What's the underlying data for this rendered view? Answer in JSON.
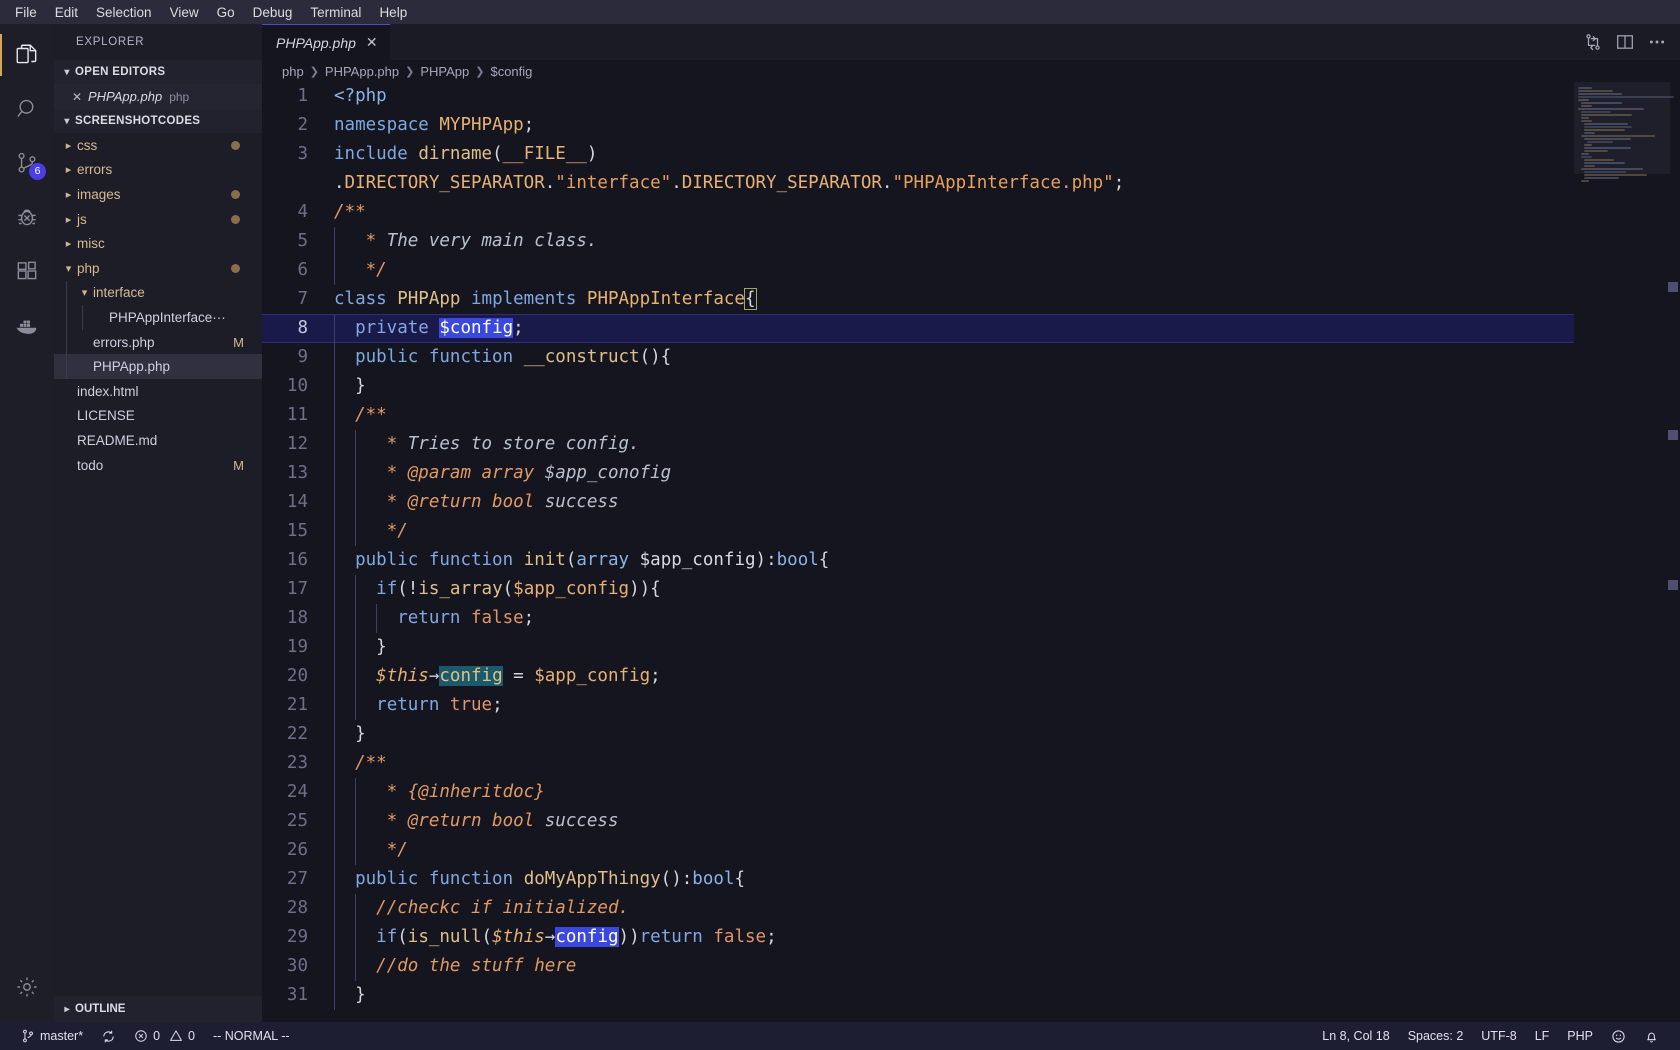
{
  "menubar": {
    "items": [
      {
        "label": "File"
      },
      {
        "label": "Edit"
      },
      {
        "label": "Selection"
      },
      {
        "label": "View"
      },
      {
        "label": "Go"
      },
      {
        "label": "Debug"
      },
      {
        "label": "Terminal"
      },
      {
        "label": "Help"
      }
    ]
  },
  "activitybar": {
    "items": [
      {
        "icon": "files-explorer-icon",
        "name": "explorer",
        "active": true,
        "badge": ""
      },
      {
        "icon": "search-icon",
        "name": "search",
        "active": false,
        "badge": ""
      },
      {
        "icon": "source-control-icon",
        "name": "source-control",
        "active": false,
        "badge": "6"
      },
      {
        "icon": "debug-icon",
        "name": "debug",
        "active": false,
        "badge": ""
      },
      {
        "icon": "extensions-icon",
        "name": "extensions",
        "active": false,
        "badge": ""
      },
      {
        "icon": "docker-icon",
        "name": "docker",
        "active": false,
        "badge": ""
      }
    ],
    "settings_icon": "gear-icon"
  },
  "sidebar": {
    "title": "EXPLORER",
    "open_editors": {
      "label": "OPEN EDITORS",
      "expanded": true,
      "items": [
        {
          "name": "PHPApp.php",
          "description": "php",
          "close_icon": "close-icon"
        }
      ]
    },
    "workspace": {
      "label": "SCREENSHOTCODES",
      "expanded": true
    },
    "tree": [
      {
        "label": "css",
        "type": "folder",
        "expanded": false,
        "depth": 1,
        "dot": true,
        "status": ""
      },
      {
        "label": "errors",
        "type": "folder",
        "expanded": false,
        "depth": 1,
        "dot": false,
        "status": ""
      },
      {
        "label": "images",
        "type": "folder",
        "expanded": false,
        "depth": 1,
        "dot": true,
        "status": ""
      },
      {
        "label": "js",
        "type": "folder",
        "expanded": false,
        "depth": 1,
        "dot": true,
        "status": ""
      },
      {
        "label": "misc",
        "type": "folder",
        "expanded": false,
        "depth": 1,
        "dot": false,
        "status": ""
      },
      {
        "label": "php",
        "type": "folder",
        "expanded": true,
        "depth": 1,
        "dot": true,
        "status": ""
      },
      {
        "label": "interface",
        "type": "folder",
        "expanded": true,
        "depth": 2,
        "dot": false,
        "status": ""
      },
      {
        "label": "PHPAppInterface···",
        "type": "file",
        "expanded": false,
        "depth": 3,
        "dot": false,
        "status": ""
      },
      {
        "label": "errors.php",
        "type": "file",
        "expanded": false,
        "depth": 2,
        "dot": false,
        "status": "M"
      },
      {
        "label": "PHPApp.php",
        "type": "file",
        "expanded": false,
        "depth": 2,
        "dot": false,
        "status": "",
        "selected": true
      },
      {
        "label": "index.html",
        "type": "file",
        "expanded": false,
        "depth": 1,
        "dot": false,
        "status": ""
      },
      {
        "label": "LICENSE",
        "type": "file",
        "expanded": false,
        "depth": 1,
        "dot": false,
        "status": ""
      },
      {
        "label": "README.md",
        "type": "file",
        "expanded": false,
        "depth": 1,
        "dot": false,
        "status": ""
      },
      {
        "label": "todo",
        "type": "file",
        "expanded": false,
        "depth": 1,
        "dot": false,
        "status": "M"
      }
    ],
    "outline": {
      "label": "OUTLINE",
      "expanded": false
    }
  },
  "editor": {
    "tab": {
      "name": "PHPApp.php",
      "close_icon": "close-icon",
      "dirty": false
    },
    "actions": [
      {
        "icon": "split-diff-icon",
        "name": "compare-changes"
      },
      {
        "icon": "split-editor-icon",
        "name": "split-editor"
      },
      {
        "icon": "more-actions-icon",
        "name": "more-actions"
      }
    ],
    "breadcrumbs": [
      "php",
      "PHPApp.php",
      "PHPApp",
      "$config"
    ],
    "lines": [
      {
        "n": "1",
        "indent": 0,
        "tokens": [
          {
            "t": "<?php",
            "c": "t-tag"
          }
        ]
      },
      {
        "n": "2",
        "indent": 0,
        "tokens": [
          {
            "t": "namespace",
            "c": "t-kw"
          },
          {
            "t": " ",
            "c": "t-plain"
          },
          {
            "t": "MYPHPApp",
            "c": "t-var"
          },
          {
            "t": ";",
            "c": "t-punc"
          }
        ]
      },
      {
        "n": "3",
        "indent": 0,
        "tokens": [
          {
            "t": "include",
            "c": "t-kw"
          },
          {
            "t": " ",
            "c": "t-plain"
          },
          {
            "t": "dirname",
            "c": "t-fn"
          },
          {
            "t": "(",
            "c": "t-punc"
          },
          {
            "t": "__FILE__",
            "c": "t-var"
          },
          {
            "t": ")",
            "c": "t-punc"
          }
        ]
      },
      {
        "n": "",
        "indent": 0,
        "tokens": [
          {
            "t": ".",
            "c": "t-punc"
          },
          {
            "t": "DIRECTORY_SEPARATOR",
            "c": "t-var"
          },
          {
            "t": ".",
            "c": "t-punc"
          },
          {
            "t": "\"interface\"",
            "c": "t-str"
          },
          {
            "t": ".",
            "c": "t-punc"
          },
          {
            "t": "DIRECTORY_SEPARATOR",
            "c": "t-var"
          },
          {
            "t": ".",
            "c": "t-punc"
          },
          {
            "t": "\"PHPAppInterface.php\"",
            "c": "t-str"
          },
          {
            "t": ";",
            "c": "t-punc"
          }
        ]
      },
      {
        "n": "4",
        "indent": 0,
        "tokens": [
          {
            "t": "/**",
            "c": "t-cmt-d"
          }
        ]
      },
      {
        "n": "5",
        "indent": 1,
        "tokens": [
          {
            "t": " * ",
            "c": "t-cmt-d"
          },
          {
            "t": "The very main class.",
            "c": "t-cmt-w"
          }
        ]
      },
      {
        "n": "6",
        "indent": 1,
        "tokens": [
          {
            "t": " */",
            "c": "t-cmt-d"
          }
        ]
      },
      {
        "n": "7",
        "indent": 0,
        "tokens": [
          {
            "t": "class",
            "c": "t-kw"
          },
          {
            "t": " ",
            "c": "t-plain"
          },
          {
            "t": "PHPApp",
            "c": "t-fn"
          },
          {
            "t": " ",
            "c": "t-plain"
          },
          {
            "t": "implements",
            "c": "t-kw"
          },
          {
            "t": " ",
            "c": "t-plain"
          },
          {
            "t": "PHPAppInterface",
            "c": "t-var"
          },
          {
            "t": "{",
            "c": "t-punc brk"
          }
        ]
      },
      {
        "n": "8",
        "indent": 1,
        "highlight": true,
        "cursor": true,
        "tokens": [
          {
            "t": "private",
            "c": "t-kw"
          },
          {
            "t": " ",
            "c": "t-plain"
          },
          {
            "t": "$config",
            "c": "t-var sel"
          },
          {
            "t": ";",
            "c": "t-punc"
          }
        ]
      },
      {
        "n": "9",
        "indent": 1,
        "tokens": [
          {
            "t": "public",
            "c": "t-kw"
          },
          {
            "t": " ",
            "c": "t-plain"
          },
          {
            "t": "function",
            "c": "t-kw"
          },
          {
            "t": " ",
            "c": "t-plain"
          },
          {
            "t": "__construct",
            "c": "t-fn"
          },
          {
            "t": "(){",
            "c": "t-punc"
          }
        ]
      },
      {
        "n": "10",
        "indent": 1,
        "tokens": [
          {
            "t": "}",
            "c": "t-punc"
          }
        ]
      },
      {
        "n": "11",
        "indent": 1,
        "tokens": [
          {
            "t": "/**",
            "c": "t-cmt-d"
          }
        ]
      },
      {
        "n": "12",
        "indent": 2,
        "tokens": [
          {
            "t": " * ",
            "c": "t-cmt-d"
          },
          {
            "t": "Tries to store config.",
            "c": "t-cmt-w"
          }
        ]
      },
      {
        "n": "13",
        "indent": 2,
        "tokens": [
          {
            "t": " * ",
            "c": "t-cmt-d"
          },
          {
            "t": "@param array",
            "c": "t-cmt-d"
          },
          {
            "t": " ",
            "c": "t-plain"
          },
          {
            "t": "$app_conofig",
            "c": "t-cmt-w"
          }
        ]
      },
      {
        "n": "14",
        "indent": 2,
        "tokens": [
          {
            "t": " * ",
            "c": "t-cmt-d"
          },
          {
            "t": "@return bool",
            "c": "t-cmt-d"
          },
          {
            "t": " ",
            "c": "t-plain"
          },
          {
            "t": "success",
            "c": "t-cmt-w"
          }
        ]
      },
      {
        "n": "15",
        "indent": 2,
        "tokens": [
          {
            "t": " */",
            "c": "t-cmt-d"
          }
        ]
      },
      {
        "n": "16",
        "indent": 1,
        "tokens": [
          {
            "t": "public",
            "c": "t-kw"
          },
          {
            "t": " ",
            "c": "t-plain"
          },
          {
            "t": "function",
            "c": "t-kw"
          },
          {
            "t": " ",
            "c": "t-plain"
          },
          {
            "t": "init",
            "c": "t-fn"
          },
          {
            "t": "(",
            "c": "t-punc"
          },
          {
            "t": "array",
            "c": "t-kw2"
          },
          {
            "t": " ",
            "c": "t-plain"
          },
          {
            "t": "$app_config",
            "c": "t-plain"
          },
          {
            "t": ")",
            "c": "t-punc"
          },
          {
            "t": ":",
            "c": "t-punc"
          },
          {
            "t": "bool",
            "c": "t-type"
          },
          {
            "t": "{",
            "c": "t-punc"
          }
        ]
      },
      {
        "n": "17",
        "indent": 2,
        "tokens": [
          {
            "t": "if",
            "c": "t-kw"
          },
          {
            "t": "(!",
            "c": "t-punc"
          },
          {
            "t": "is_array",
            "c": "t-fn"
          },
          {
            "t": "(",
            "c": "t-punc"
          },
          {
            "t": "$app_config",
            "c": "t-var"
          },
          {
            "t": ")){",
            "c": "t-punc"
          }
        ]
      },
      {
        "n": "18",
        "indent": 3,
        "tokens": [
          {
            "t": "return",
            "c": "t-kw"
          },
          {
            "t": " ",
            "c": "t-plain"
          },
          {
            "t": "false",
            "c": "t-const"
          },
          {
            "t": ";",
            "c": "t-punc"
          }
        ]
      },
      {
        "n": "19",
        "indent": 2,
        "tokens": [
          {
            "t": "}",
            "c": "t-punc"
          }
        ]
      },
      {
        "n": "20",
        "indent": 2,
        "tokens": [
          {
            "t": "$this",
            "c": "t-this"
          },
          {
            "t": "→",
            "c": "t-punc"
          },
          {
            "t": "config",
            "c": "t-fn occ"
          },
          {
            "t": " = ",
            "c": "t-punc"
          },
          {
            "t": "$app_config",
            "c": "t-var"
          },
          {
            "t": ";",
            "c": "t-punc"
          }
        ]
      },
      {
        "n": "21",
        "indent": 2,
        "tokens": [
          {
            "t": "return",
            "c": "t-kw"
          },
          {
            "t": " ",
            "c": "t-plain"
          },
          {
            "t": "true",
            "c": "t-const"
          },
          {
            "t": ";",
            "c": "t-punc"
          }
        ]
      },
      {
        "n": "22",
        "indent": 1,
        "tokens": [
          {
            "t": "}",
            "c": "t-punc"
          }
        ]
      },
      {
        "n": "23",
        "indent": 1,
        "tokens": [
          {
            "t": "/**",
            "c": "t-cmt-d"
          }
        ]
      },
      {
        "n": "24",
        "indent": 2,
        "tokens": [
          {
            "t": " * ",
            "c": "t-cmt-d"
          },
          {
            "t": "{@inheritdoc}",
            "c": "t-cmt-d"
          }
        ]
      },
      {
        "n": "25",
        "indent": 2,
        "tokens": [
          {
            "t": " * ",
            "c": "t-cmt-d"
          },
          {
            "t": "@return bool",
            "c": "t-cmt-d"
          },
          {
            "t": " ",
            "c": "t-plain"
          },
          {
            "t": "success",
            "c": "t-cmt-w"
          }
        ]
      },
      {
        "n": "26",
        "indent": 2,
        "tokens": [
          {
            "t": " */",
            "c": "t-cmt-d"
          }
        ]
      },
      {
        "n": "27",
        "indent": 1,
        "tokens": [
          {
            "t": "public",
            "c": "t-kw"
          },
          {
            "t": " ",
            "c": "t-plain"
          },
          {
            "t": "function",
            "c": "t-kw"
          },
          {
            "t": " ",
            "c": "t-plain"
          },
          {
            "t": "doMyAppThingy",
            "c": "t-fn"
          },
          {
            "t": "()",
            "c": "t-punc"
          },
          {
            "t": ":",
            "c": "t-punc"
          },
          {
            "t": "bool",
            "c": "t-type"
          },
          {
            "t": "{",
            "c": "t-punc"
          }
        ]
      },
      {
        "n": "28",
        "indent": 2,
        "tokens": [
          {
            "t": "//checkc if initialized.",
            "c": "t-cmt-d"
          }
        ]
      },
      {
        "n": "29",
        "indent": 2,
        "tokens": [
          {
            "t": "if",
            "c": "t-kw"
          },
          {
            "t": "(",
            "c": "t-punc"
          },
          {
            "t": "is_null",
            "c": "t-fn"
          },
          {
            "t": "(",
            "c": "t-punc"
          },
          {
            "t": "$this",
            "c": "t-this"
          },
          {
            "t": "→",
            "c": "t-punc"
          },
          {
            "t": "config",
            "c": "t-fn sel"
          },
          {
            "t": "))",
            "c": "t-punc"
          },
          {
            "t": "return",
            "c": "t-kw"
          },
          {
            "t": " ",
            "c": "t-plain"
          },
          {
            "t": "false",
            "c": "t-const"
          },
          {
            "t": ";",
            "c": "t-punc"
          }
        ]
      },
      {
        "n": "30",
        "indent": 2,
        "tokens": [
          {
            "t": "//do the stuff here",
            "c": "t-cmt-d"
          }
        ]
      },
      {
        "n": "31",
        "indent": 1,
        "tokens": [
          {
            "t": "}",
            "c": "t-punc"
          }
        ]
      }
    ]
  },
  "statusbar": {
    "left": [
      {
        "icon": "source-control-branch-icon",
        "label": "master*",
        "name": "branch-status"
      },
      {
        "icon": "sync-icon",
        "label": "",
        "name": "sync-status"
      },
      {
        "icon": "error-icon",
        "label": "0",
        "icon2": "warning-icon",
        "label2": "0",
        "name": "problems-status"
      },
      {
        "icon": "",
        "label": "-- NORMAL --",
        "name": "vim-mode-status"
      }
    ],
    "right": [
      {
        "label": "Ln 8, Col 18",
        "name": "cursor-position-status"
      },
      {
        "label": "Spaces: 2",
        "name": "indentation-status"
      },
      {
        "label": "UTF-8",
        "name": "encoding-status"
      },
      {
        "label": "LF",
        "name": "eol-status"
      },
      {
        "label": "PHP",
        "name": "language-mode-status"
      },
      {
        "icon": "feedback-smiley-icon",
        "label": "",
        "name": "feedback-button"
      },
      {
        "icon": "bell-icon",
        "label": "",
        "name": "notifications-button"
      }
    ]
  },
  "colors": {
    "accent": "#4b3fe4",
    "activity_active": "#d8a657",
    "statusbar_bg": "#1e1e33",
    "editor_bg": "#15151f",
    "sidebar_bg": "#1d1d27",
    "selection": "#3b48e0",
    "occurrence": "#1b5a6b"
  }
}
